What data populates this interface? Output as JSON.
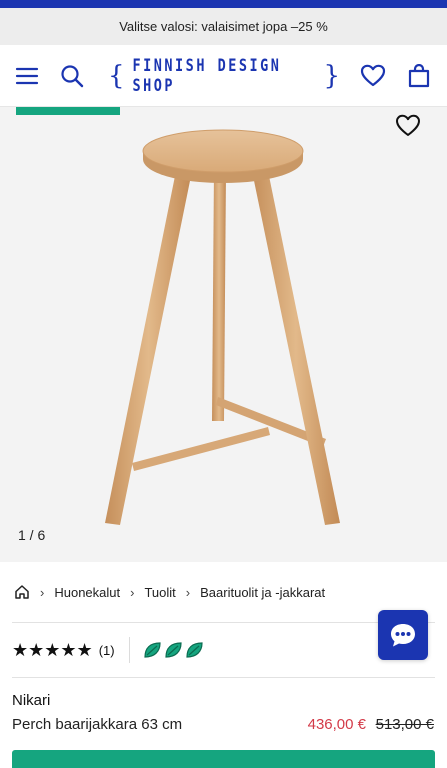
{
  "promo": {
    "text": "Valitse valosi: valaisimet jopa –25 %"
  },
  "header": {
    "logo_text": "FINNISH DESIGN SHOP",
    "icons": [
      "menu-icon",
      "search-icon",
      "heart-icon",
      "bag-icon"
    ]
  },
  "gallery": {
    "counter": "1 / 6"
  },
  "breadcrumb": {
    "items": [
      "Huonekalut",
      "Tuolit",
      "Baarituolit ja -jakkarat"
    ]
  },
  "rating": {
    "stars": "★★★★★",
    "count": "(1)",
    "leaf_count": 3
  },
  "product": {
    "brand": "Nikari",
    "name": "Perch baarijakkara 63 cm",
    "price": "436,00 €",
    "old_price": "513,00 €"
  },
  "colors": {
    "brand_blue": "#1b35b1",
    "green": "#15a57f",
    "sale_red": "#d33a48",
    "wood": "#d8aa78"
  }
}
